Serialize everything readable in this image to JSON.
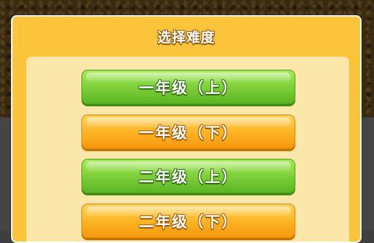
{
  "dialog": {
    "title": "选择难度"
  },
  "levels": [
    {
      "label": "一年级（上）",
      "style": "green"
    },
    {
      "label": "一年级（下）",
      "style": "orange"
    },
    {
      "label": "二年级（上）",
      "style": "green"
    },
    {
      "label": "二年级（下）",
      "style": "orange"
    }
  ],
  "colors": {
    "dialog_bg": "#fcc43a",
    "panel_bg": "#fbe7a9",
    "green_button": "#7ed03a",
    "orange_button": "#ffb527"
  }
}
